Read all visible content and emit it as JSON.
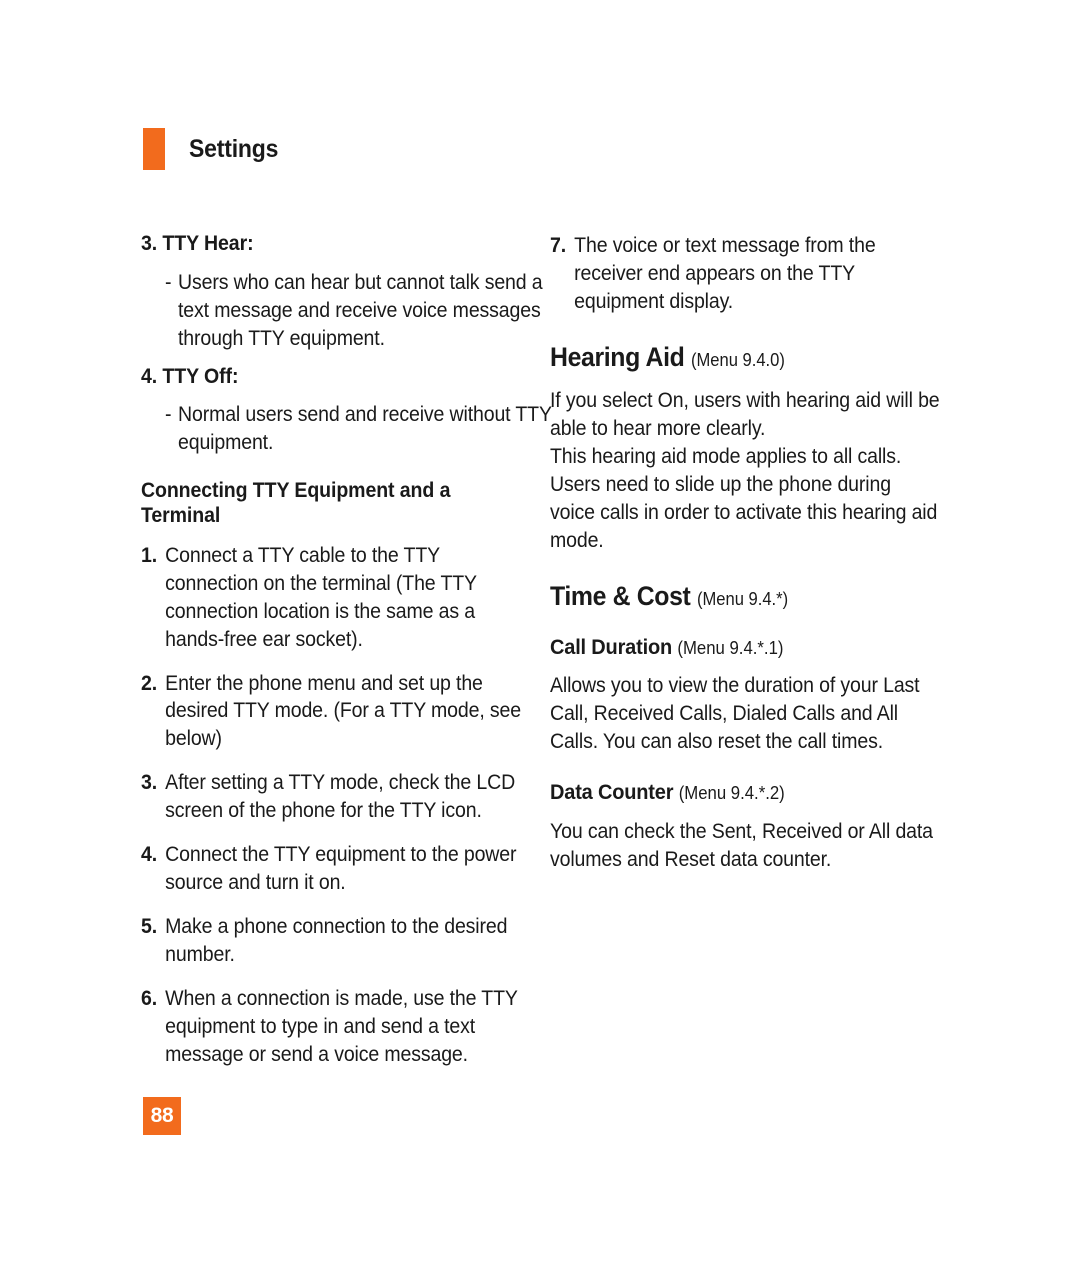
{
  "header": {
    "title": "Settings",
    "accent_color": "#F26B1D"
  },
  "page_number": "88",
  "left_column": {
    "tty_hear_heading": "3. TTY Hear:",
    "tty_hear_bullet_dash": "-",
    "tty_hear_bullet": "Users who can hear but cannot talk send a text message and receive voice messages through TTY equipment.",
    "tty_off_heading": "4. TTY Off:",
    "tty_off_bullet_dash": "-",
    "tty_off_bullet": "Normal users send and receive without TTY equipment.",
    "connecting_heading": "Connecting TTY Equipment and a Terminal",
    "steps": [
      {
        "num": "1.",
        "text": "Connect a TTY cable to the TTY connection on the terminal (The TTY connection location is the same as a hands-free ear socket)."
      },
      {
        "num": "2.",
        "text": "Enter the phone menu and set up the desired TTY mode. (For a TTY mode, see below)"
      },
      {
        "num": "3.",
        "text": "After setting a TTY mode, check the LCD screen of the phone for the TTY icon."
      },
      {
        "num": "4.",
        "text": "Connect the TTY equipment to the power source and turn it on."
      },
      {
        "num": "5.",
        "text": "Make a phone connection to the desired number."
      },
      {
        "num": "6.",
        "text": "When a connection is made, use the TTY equipment to type in and send a text message or send a voice message."
      }
    ]
  },
  "right_column": {
    "step7": {
      "num": "7.",
      "text": "The voice or text message from the receiver end appears on the TTY equipment display."
    },
    "hearing_aid": {
      "title": "Hearing Aid",
      "menu_ref": "(Menu 9.4.0)",
      "paragraph_1": "If you select On, users with hearing aid will be able to hear more clearly.",
      "paragraph_2": "This hearing aid mode applies to all calls.",
      "paragraph_3": "Users need to slide up the phone during voice calls in order to activate this hearing aid mode."
    },
    "time_and_cost": {
      "title": "Time & Cost",
      "menu_ref": "(Menu 9.4.*)"
    },
    "call_duration": {
      "title": "Call Duration",
      "menu_ref": "(Menu 9.4.*.1)",
      "paragraph": "Allows you to view the duration of your Last Call, Received Calls, Dialed Calls and All Calls. You can also reset the call times."
    },
    "data_counter": {
      "title": "Data Counter",
      "menu_ref": "(Menu 9.4.*.2)",
      "paragraph": "You can check the Sent, Received or All data volumes and Reset data counter."
    }
  }
}
